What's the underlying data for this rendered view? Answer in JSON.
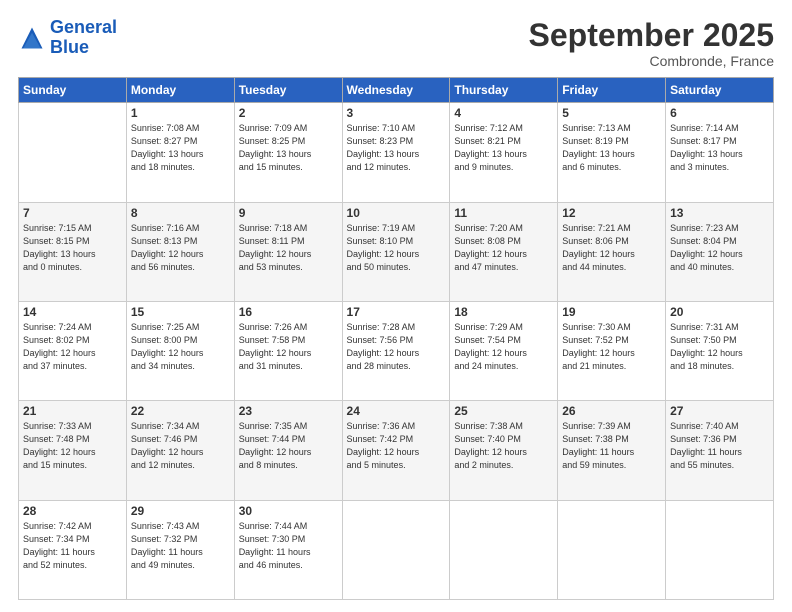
{
  "header": {
    "logo_line1": "General",
    "logo_line2": "Blue",
    "month": "September 2025",
    "location": "Combronde, France"
  },
  "weekdays": [
    "Sunday",
    "Monday",
    "Tuesday",
    "Wednesday",
    "Thursday",
    "Friday",
    "Saturday"
  ],
  "weeks": [
    [
      {
        "day": "",
        "info": ""
      },
      {
        "day": "1",
        "info": "Sunrise: 7:08 AM\nSunset: 8:27 PM\nDaylight: 13 hours\nand 18 minutes."
      },
      {
        "day": "2",
        "info": "Sunrise: 7:09 AM\nSunset: 8:25 PM\nDaylight: 13 hours\nand 15 minutes."
      },
      {
        "day": "3",
        "info": "Sunrise: 7:10 AM\nSunset: 8:23 PM\nDaylight: 13 hours\nand 12 minutes."
      },
      {
        "day": "4",
        "info": "Sunrise: 7:12 AM\nSunset: 8:21 PM\nDaylight: 13 hours\nand 9 minutes."
      },
      {
        "day": "5",
        "info": "Sunrise: 7:13 AM\nSunset: 8:19 PM\nDaylight: 13 hours\nand 6 minutes."
      },
      {
        "day": "6",
        "info": "Sunrise: 7:14 AM\nSunset: 8:17 PM\nDaylight: 13 hours\nand 3 minutes."
      }
    ],
    [
      {
        "day": "7",
        "info": "Sunrise: 7:15 AM\nSunset: 8:15 PM\nDaylight: 13 hours\nand 0 minutes."
      },
      {
        "day": "8",
        "info": "Sunrise: 7:16 AM\nSunset: 8:13 PM\nDaylight: 12 hours\nand 56 minutes."
      },
      {
        "day": "9",
        "info": "Sunrise: 7:18 AM\nSunset: 8:11 PM\nDaylight: 12 hours\nand 53 minutes."
      },
      {
        "day": "10",
        "info": "Sunrise: 7:19 AM\nSunset: 8:10 PM\nDaylight: 12 hours\nand 50 minutes."
      },
      {
        "day": "11",
        "info": "Sunrise: 7:20 AM\nSunset: 8:08 PM\nDaylight: 12 hours\nand 47 minutes."
      },
      {
        "day": "12",
        "info": "Sunrise: 7:21 AM\nSunset: 8:06 PM\nDaylight: 12 hours\nand 44 minutes."
      },
      {
        "day": "13",
        "info": "Sunrise: 7:23 AM\nSunset: 8:04 PM\nDaylight: 12 hours\nand 40 minutes."
      }
    ],
    [
      {
        "day": "14",
        "info": "Sunrise: 7:24 AM\nSunset: 8:02 PM\nDaylight: 12 hours\nand 37 minutes."
      },
      {
        "day": "15",
        "info": "Sunrise: 7:25 AM\nSunset: 8:00 PM\nDaylight: 12 hours\nand 34 minutes."
      },
      {
        "day": "16",
        "info": "Sunrise: 7:26 AM\nSunset: 7:58 PM\nDaylight: 12 hours\nand 31 minutes."
      },
      {
        "day": "17",
        "info": "Sunrise: 7:28 AM\nSunset: 7:56 PM\nDaylight: 12 hours\nand 28 minutes."
      },
      {
        "day": "18",
        "info": "Sunrise: 7:29 AM\nSunset: 7:54 PM\nDaylight: 12 hours\nand 24 minutes."
      },
      {
        "day": "19",
        "info": "Sunrise: 7:30 AM\nSunset: 7:52 PM\nDaylight: 12 hours\nand 21 minutes."
      },
      {
        "day": "20",
        "info": "Sunrise: 7:31 AM\nSunset: 7:50 PM\nDaylight: 12 hours\nand 18 minutes."
      }
    ],
    [
      {
        "day": "21",
        "info": "Sunrise: 7:33 AM\nSunset: 7:48 PM\nDaylight: 12 hours\nand 15 minutes."
      },
      {
        "day": "22",
        "info": "Sunrise: 7:34 AM\nSunset: 7:46 PM\nDaylight: 12 hours\nand 12 minutes."
      },
      {
        "day": "23",
        "info": "Sunrise: 7:35 AM\nSunset: 7:44 PM\nDaylight: 12 hours\nand 8 minutes."
      },
      {
        "day": "24",
        "info": "Sunrise: 7:36 AM\nSunset: 7:42 PM\nDaylight: 12 hours\nand 5 minutes."
      },
      {
        "day": "25",
        "info": "Sunrise: 7:38 AM\nSunset: 7:40 PM\nDaylight: 12 hours\nand 2 minutes."
      },
      {
        "day": "26",
        "info": "Sunrise: 7:39 AM\nSunset: 7:38 PM\nDaylight: 11 hours\nand 59 minutes."
      },
      {
        "day": "27",
        "info": "Sunrise: 7:40 AM\nSunset: 7:36 PM\nDaylight: 11 hours\nand 55 minutes."
      }
    ],
    [
      {
        "day": "28",
        "info": "Sunrise: 7:42 AM\nSunset: 7:34 PM\nDaylight: 11 hours\nand 52 minutes."
      },
      {
        "day": "29",
        "info": "Sunrise: 7:43 AM\nSunset: 7:32 PM\nDaylight: 11 hours\nand 49 minutes."
      },
      {
        "day": "30",
        "info": "Sunrise: 7:44 AM\nSunset: 7:30 PM\nDaylight: 11 hours\nand 46 minutes."
      },
      {
        "day": "",
        "info": ""
      },
      {
        "day": "",
        "info": ""
      },
      {
        "day": "",
        "info": ""
      },
      {
        "day": "",
        "info": ""
      }
    ]
  ]
}
